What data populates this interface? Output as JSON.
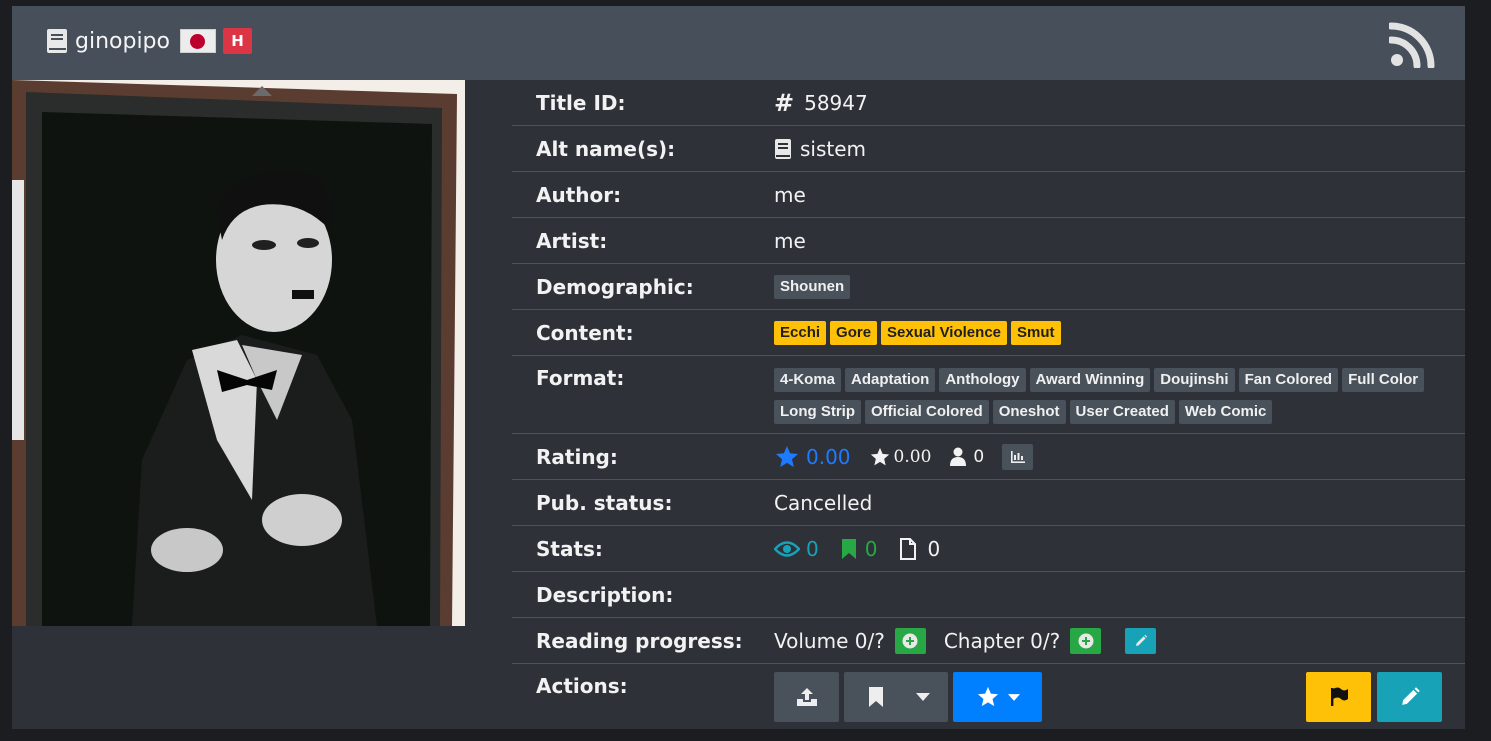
{
  "header": {
    "title": "ginopipo",
    "flag_icon": "japan-flag-icon",
    "badge": "H",
    "rss_icon": "rss-icon"
  },
  "cover": {
    "alt": "cover-image"
  },
  "info": {
    "title_id": {
      "label": "Title ID:",
      "value": "58947"
    },
    "alt_names": {
      "label": "Alt name(s):",
      "value": "sistem"
    },
    "author": {
      "label": "Author:",
      "value": "me"
    },
    "artist": {
      "label": "Artist:",
      "value": "me"
    },
    "demographic": {
      "label": "Demographic:",
      "tags": [
        "Shounen"
      ]
    },
    "content": {
      "label": "Content:",
      "tags": [
        "Ecchi",
        "Gore",
        "Sexual Violence",
        "Smut"
      ]
    },
    "format": {
      "label": "Format:",
      "tags": [
        "4-Koma",
        "Adaptation",
        "Anthology",
        "Award Winning",
        "Doujinshi",
        "Fan Colored",
        "Full Color",
        "Long Strip",
        "Official Colored",
        "Oneshot",
        "User Created",
        "Web Comic"
      ]
    },
    "rating": {
      "label": "Rating:",
      "bayesian": "0.00",
      "mean": "0.00",
      "users": "0"
    },
    "pub_status": {
      "label": "Pub. status:",
      "value": "Cancelled"
    },
    "stats": {
      "label": "Stats:",
      "views": "0",
      "follows": "0",
      "chapters": "0"
    },
    "description": {
      "label": "Description:"
    },
    "reading_progress": {
      "label": "Reading progress:",
      "volume": "Volume 0/?",
      "chapter": "Chapter 0/?"
    },
    "actions": {
      "label": "Actions:"
    }
  },
  "colors": {
    "header_bg": "#474f5a",
    "card_bg": "#2e3238",
    "tag_gray": "#49515b",
    "tag_yellow": "#ffc107",
    "primary": "#0080ff",
    "warning": "#ffc107",
    "info": "#17a2b8",
    "success": "#28a745",
    "danger": "#dc3545"
  }
}
